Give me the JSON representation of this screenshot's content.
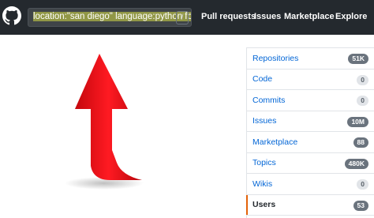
{
  "header": {
    "search_text": "location:\"san diego\" language:python foll",
    "search_shortcut": "/",
    "nav": [
      "Pull requests",
      "Issues",
      "Marketplace",
      "Explore"
    ]
  },
  "menu": [
    {
      "label": "Repositories",
      "count": "51K",
      "selected": false
    },
    {
      "label": "Code",
      "count": "0",
      "selected": false
    },
    {
      "label": "Commits",
      "count": "0",
      "selected": false
    },
    {
      "label": "Issues",
      "count": "10M",
      "selected": false
    },
    {
      "label": "Marketplace",
      "count": "88",
      "selected": false
    },
    {
      "label": "Topics",
      "count": "480K",
      "selected": false
    },
    {
      "label": "Wikis",
      "count": "0",
      "selected": false
    },
    {
      "label": "Users",
      "count": "53",
      "selected": true
    }
  ],
  "colors": {
    "header_bg": "#24292e",
    "link": "#0366d6",
    "arrow": "#e8141b",
    "selected_border": "#e36209"
  }
}
